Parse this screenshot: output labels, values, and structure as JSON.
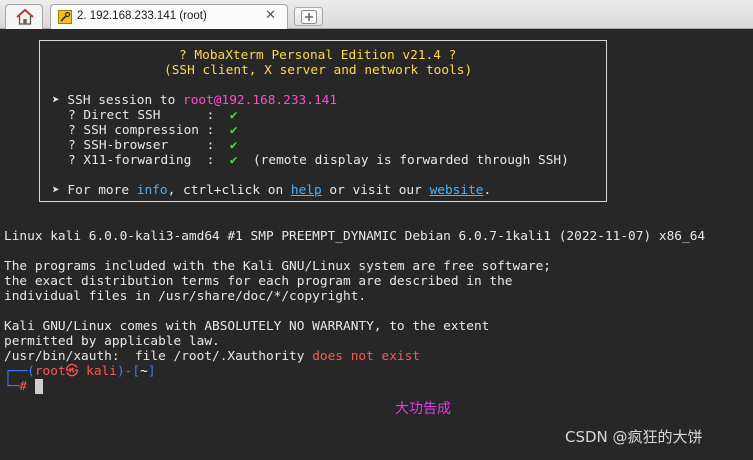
{
  "tabs": {
    "home_icon": "home-icon",
    "session_label": "2. 192.168.233.141 (root)",
    "close_label": "✕",
    "new_tab_icon": "plus-icon"
  },
  "banner": {
    "title": "? MobaXterm Personal Edition v21.4 ?",
    "subtitle": "(SSH client, X server and network tools)",
    "session_prefix": "➤ SSH session to ",
    "session_target": "root@192.168.233.141",
    "features": [
      {
        "name": "? Direct SSH      :",
        "status": "✔",
        "note": ""
      },
      {
        "name": "? SSH compression :",
        "status": "✔",
        "note": ""
      },
      {
        "name": "? SSH-browser     :",
        "status": "✔",
        "note": ""
      },
      {
        "name": "? X11-forwarding  :",
        "status": "✔",
        "note": "(remote display is forwarded through SSH)"
      }
    ],
    "more_prefix": "➤ For more ",
    "more_info": "info",
    "more_middle": ", ctrl+click on ",
    "more_help": "help",
    "more_or": " or visit our ",
    "more_website": "website",
    "more_end": "."
  },
  "output": {
    "uname": "Linux kali 6.0.0-kali3-amd64 #1 SMP PREEMPT_DYNAMIC Debian 6.0.7-1kali1 (2022-11-07) x86_64",
    "para1": [
      "The programs included with the Kali GNU/Linux system are free software;",
      "the exact distribution terms for each program are described in the",
      "individual files in /usr/share/doc/*/copyright."
    ],
    "para2": [
      "Kali GNU/Linux comes with ABSOLUTELY NO WARRANTY, to the extent",
      "permitted by applicable law."
    ],
    "xauth_prefix": "/usr/bin/xauth:  file /root/.Xauthority ",
    "xauth_error": "does not exist"
  },
  "prompt": {
    "line1_start": "┌──(",
    "user_host": "root㉿ kali",
    "line1_mid": ")-[",
    "cwd": "~",
    "line1_end": "]",
    "line2_start": "└─",
    "symbol": "#"
  },
  "annotation": "大功告成",
  "watermark": "CSDN @疯狂的大饼",
  "colors": {
    "terminal_bg": "#272727",
    "banner_yellow": "#ffd84a",
    "magenta": "#ff4dd2",
    "green": "#3fe33f",
    "link_blue": "#49b3ff",
    "error_red": "#ff5555",
    "prompt_blue": "#3a7dfc"
  }
}
